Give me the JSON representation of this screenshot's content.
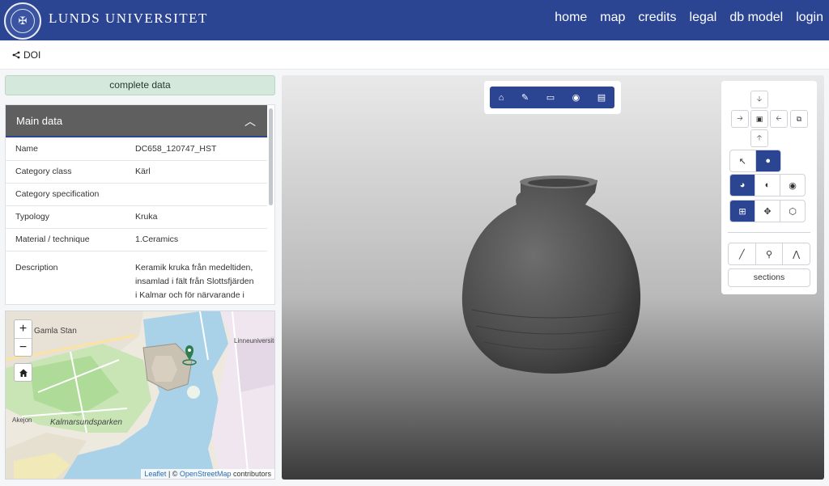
{
  "header": {
    "brand": "Lunds universitet",
    "seal_glyph": "✠",
    "nav": [
      "home",
      "map",
      "credits",
      "legal",
      "db model",
      "login"
    ]
  },
  "doi": {
    "icon": "share-icon",
    "label": "DOI"
  },
  "status": {
    "complete_label": "complete data"
  },
  "main_data": {
    "title": "Main data",
    "rows": [
      {
        "key": "Name",
        "value": "DC658_120747_HST"
      },
      {
        "key": "Category class",
        "value": "Kärl"
      },
      {
        "key": "Category specification",
        "value": ""
      },
      {
        "key": "Typology",
        "value": "Kruka"
      },
      {
        "key": "Material / technique",
        "value": "1.Ceramics"
      }
    ],
    "description": {
      "key": "Description",
      "value": "Keramik kruka från medeltiden, insamlad i fält från Slottsfjärden i Kalmar och för närvarande i Historiska museets samling i Stockholm"
    }
  },
  "map": {
    "zoom_in": "+",
    "zoom_out": "−",
    "labels": [
      "Gamla Stan",
      "Kalmarsundsparken",
      "Linneuniversitet",
      "Akejon"
    ],
    "attribution": {
      "leaflet": "Leaflet",
      "sep": " | © ",
      "osm": "OpenStreetMap",
      "suffix": " contributors"
    }
  },
  "viewer": {
    "top_toolbar": [
      "home-icon",
      "light-icon",
      "fullscreen-icon",
      "camera-icon",
      "panel-icon"
    ],
    "sections_label": "sections"
  },
  "colors": {
    "brand": "#2b4593",
    "complete_bg": "#d4e8dc",
    "panel_head": "#5f5f5f"
  }
}
